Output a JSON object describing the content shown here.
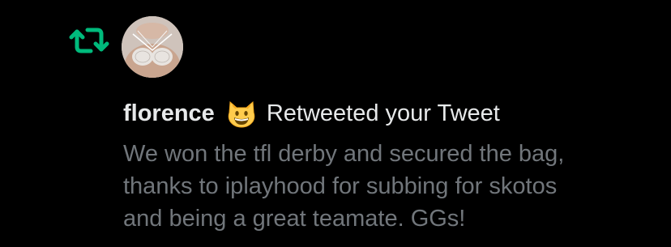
{
  "notification": {
    "type_icon": "retweet-icon",
    "user": {
      "name": "florence",
      "emoji": "grinning-cat-emoji"
    },
    "action_text": "Retweeted your Tweet",
    "tweet_lines": [
      "We won the tfl derby and secured the bag,",
      "thanks to iplayhood for subbing for skotos",
      "and being a great teamate. GGs!"
    ]
  },
  "colors": {
    "background": "#000000",
    "retweet_green": "#00ba7c",
    "primary_text": "#e7e9ea",
    "secondary_text": "#71767b"
  }
}
